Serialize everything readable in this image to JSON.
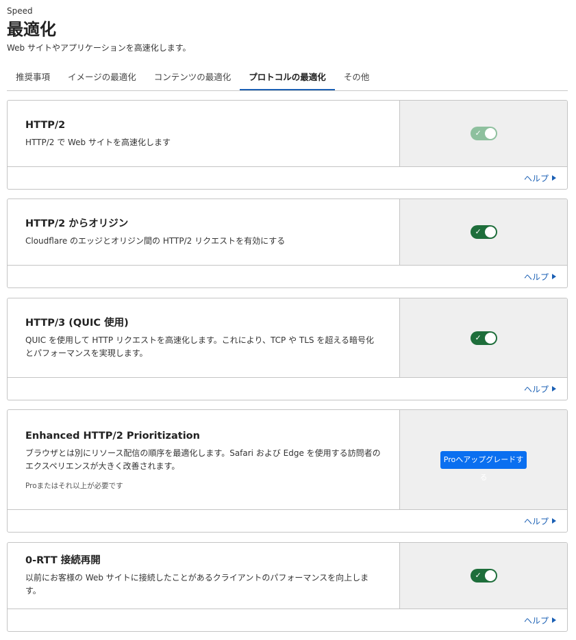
{
  "header": {
    "breadcrumb": "Speed",
    "title": "最適化",
    "subtitle": "Web サイトやアプリケーションを高速化します。"
  },
  "tabs": [
    {
      "label": "推奨事項"
    },
    {
      "label": "イメージの最適化"
    },
    {
      "label": "コンテンツの最適化"
    },
    {
      "label": "プロトコルの最適化"
    },
    {
      "label": "その他"
    }
  ],
  "active_tab": "プロトコルの最適化",
  "help_label": "ヘルプ",
  "cards": [
    {
      "title": "HTTP/2",
      "description": "HTTP/2 で Web サイトを高速化します",
      "toggle": "on-disabled"
    },
    {
      "title": "HTTP/2 からオリジン",
      "description": "Cloudflare のエッジとオリジン間の HTTP/2 リクエストを有効にする",
      "toggle": "on"
    },
    {
      "title": "HTTP/3 (QUIC 使用)",
      "description": "QUIC を使用して HTTP リクエストを高速化します。これにより、TCP や TLS を超える暗号化とパフォーマンスを実現します。",
      "toggle": "on"
    },
    {
      "title": "Enhanced HTTP/2 Prioritization",
      "description": "ブラウザとは別にリソース配信の順序を最適化します。Safari および Edge を使用する訪問者のエクスペリエンスが大きく改善されます。",
      "note": "Proまたはそれ以上が必要です",
      "button": "Proへアップグレードする"
    },
    {
      "title": "0-RTT 接続再開",
      "description": "以前にお客様の Web サイトに接続したことがあるクライアントのパフォーマンスを向上します。",
      "toggle": "on"
    }
  ],
  "colors": {
    "toggle_on": "#1e6e3b",
    "toggle_disabled": "#8ec09e",
    "accent": "#1a5fb4",
    "button": "#0a6ff0"
  }
}
